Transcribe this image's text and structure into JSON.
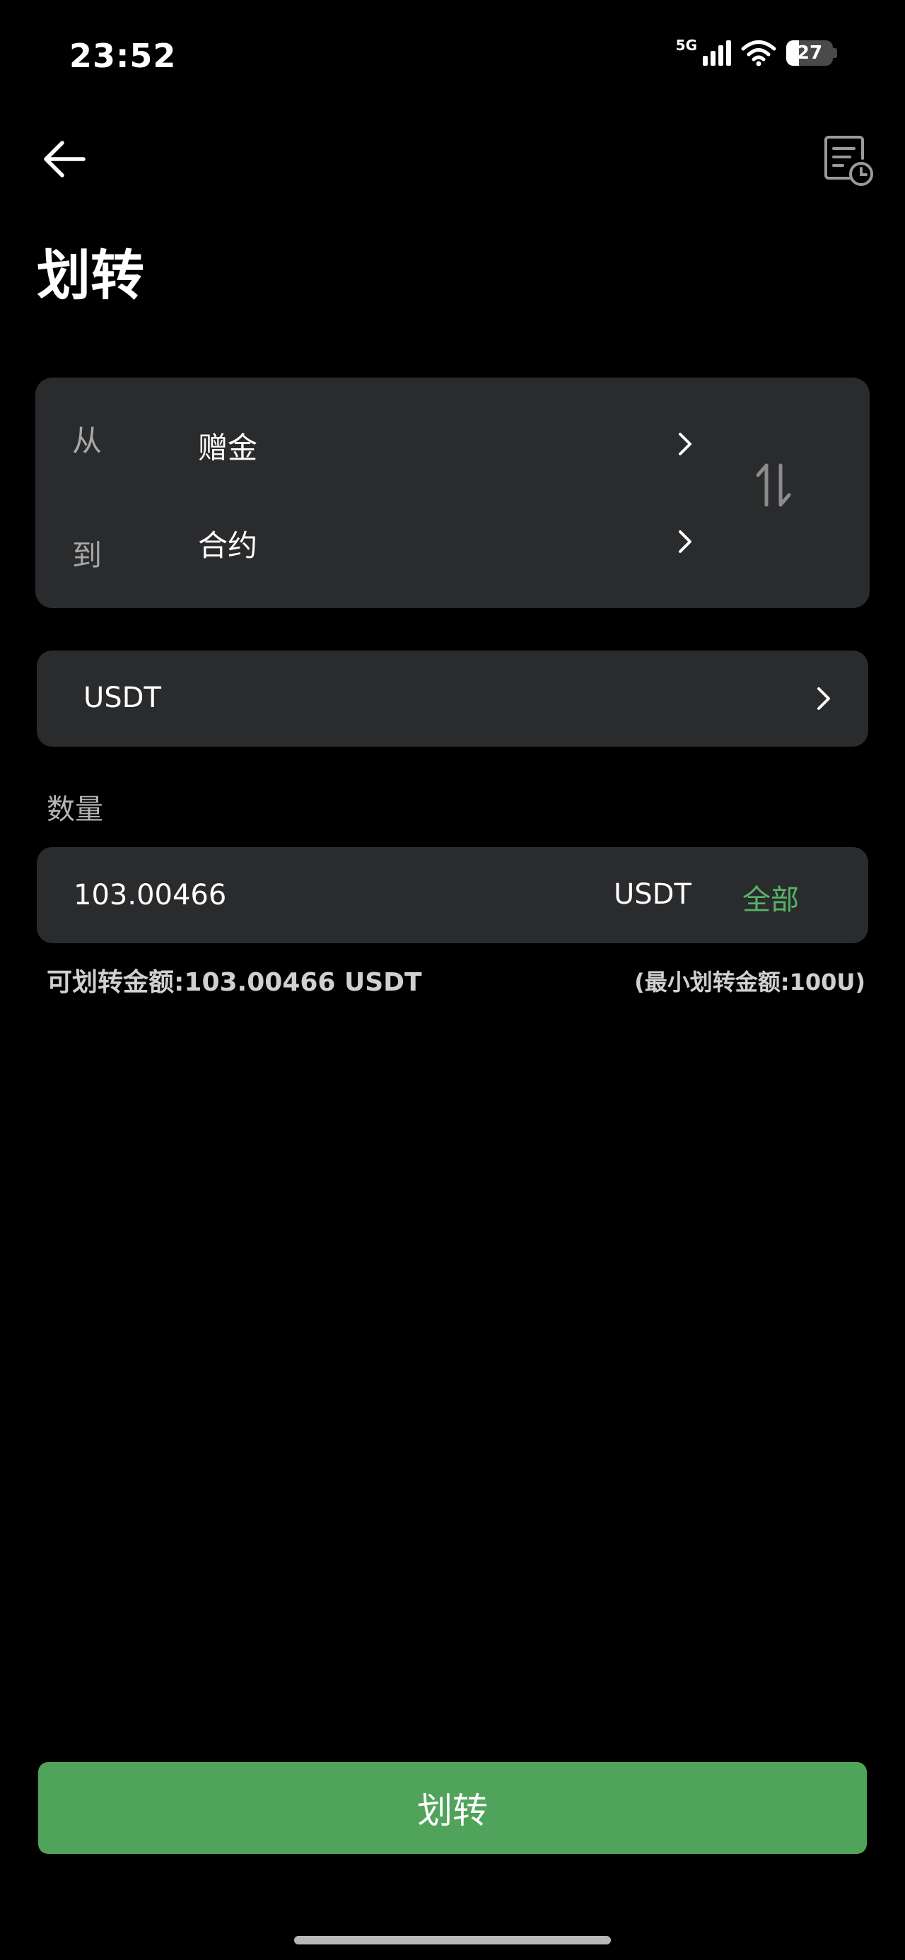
{
  "status_bar": {
    "time": "23:52",
    "network": "5G",
    "battery": "27"
  },
  "header": {
    "title": "划转"
  },
  "transfer": {
    "from_label": "从",
    "from_value": "赠金",
    "to_label": "到",
    "to_value": "合约"
  },
  "coin": {
    "value": "USDT"
  },
  "amount": {
    "label": "数量",
    "value": "103.00466",
    "unit": "USDT",
    "all_label": "全部"
  },
  "info": {
    "available": "可划转金额:103.00466 USDT",
    "minimum": "(最小划转金额:100U)"
  },
  "submit": {
    "label": "划转"
  },
  "colors": {
    "background": "#000000",
    "card": "#2a2b2d",
    "accent_green": "#4fa35a",
    "link_green": "#58b368"
  }
}
